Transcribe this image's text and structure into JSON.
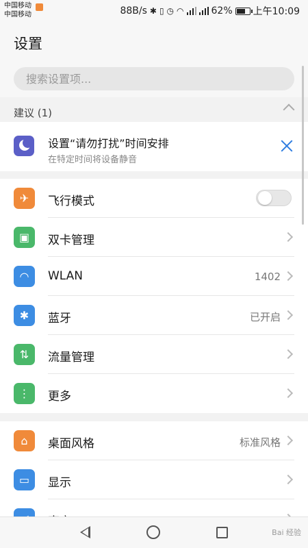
{
  "status_bar": {
    "carrier_1": "中国移动",
    "carrier_2": "中国移动",
    "speed": "88B/s",
    "battery": "62%",
    "time": "上午10:09"
  },
  "header": {
    "title": "设置"
  },
  "search": {
    "placeholder": "搜索设置项..."
  },
  "suggestions": {
    "title": "建议 (1)",
    "item": {
      "title": "设置“请勿打扰”时间安排",
      "subtitle": "在特定时间将设备静音"
    }
  },
  "group1": [
    {
      "label": "飞行模式",
      "value": "",
      "control": "toggle",
      "toggle_on": false,
      "icon": "airplane-icon",
      "color": "#f08a3a"
    },
    {
      "label": "双卡管理",
      "value": "",
      "control": "chevron",
      "icon": "sim-card-icon",
      "color": "#4ab86a"
    },
    {
      "label": "WLAN",
      "value": "1402",
      "control": "chevron",
      "icon": "wifi-icon",
      "color": "#3d8de3"
    },
    {
      "label": "蓝牙",
      "value": "已开启",
      "control": "chevron",
      "icon": "bluetooth-icon",
      "color": "#3d8de3"
    },
    {
      "label": "流量管理",
      "value": "",
      "control": "chevron",
      "icon": "data-usage-icon",
      "color": "#4ab86a"
    },
    {
      "label": "更多",
      "value": "",
      "control": "chevron",
      "icon": "more-icon",
      "color": "#4ab86a"
    }
  ],
  "group2": [
    {
      "label": "桌面风格",
      "value": "标准风格",
      "control": "chevron",
      "icon": "home-style-icon",
      "color": "#f08a3a"
    },
    {
      "label": "显示",
      "value": "",
      "control": "chevron",
      "icon": "display-icon",
      "color": "#3d8de3"
    },
    {
      "label": "声音",
      "value": "",
      "control": "chevron",
      "icon": "sound-icon",
      "color": "#3d8de3"
    }
  ],
  "watermark": "Bai 经验"
}
